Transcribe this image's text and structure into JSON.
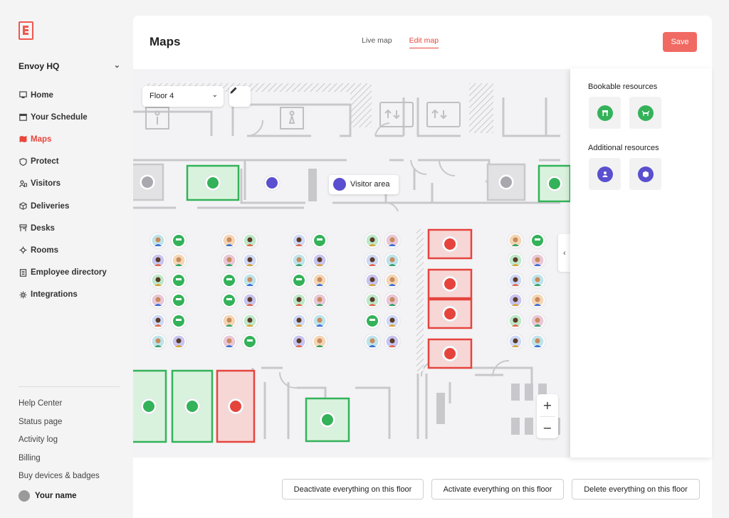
{
  "sidebar": {
    "org_name": "Envoy HQ",
    "nav": [
      {
        "label": "Home",
        "icon": "home-icon",
        "active": false
      },
      {
        "label": "Your Schedule",
        "icon": "calendar-icon",
        "active": false
      },
      {
        "label": "Maps",
        "icon": "map-icon",
        "active": true
      },
      {
        "label": "Protect",
        "icon": "shield-icon",
        "active": false
      },
      {
        "label": "Visitors",
        "icon": "visitor-badge-icon",
        "active": false
      },
      {
        "label": "Deliveries",
        "icon": "package-icon",
        "active": false
      },
      {
        "label": "Desks",
        "icon": "desk-icon",
        "active": false
      },
      {
        "label": "Rooms",
        "icon": "rooms-icon",
        "active": false
      },
      {
        "label": "Employee directory",
        "icon": "directory-icon",
        "active": false
      },
      {
        "label": "Integrations",
        "icon": "integrations-icon",
        "active": false
      }
    ],
    "footer": [
      "Help Center",
      "Status page",
      "Activity log",
      "Billing",
      "Buy devices & badges"
    ],
    "user_name": "Your name"
  },
  "header": {
    "title": "Maps",
    "tabs": [
      {
        "label": "Live map",
        "active": false
      },
      {
        "label": "Edit map",
        "active": true
      }
    ],
    "save_label": "Save"
  },
  "map": {
    "floor": "Floor 4",
    "tooltip": "Visitor area"
  },
  "panel": {
    "bookable_title": "Bookable resources",
    "additional_title": "Additional resources"
  },
  "actions": {
    "deactivate": "Deactivate everything on this floor",
    "activate": "Activate everything on this floor",
    "delete": "Delete everything on this floor"
  },
  "colors": {
    "accent": "#e9463c",
    "save": "#f06a63",
    "available": "#34b25a",
    "unavailable": "#e5443d",
    "visitor": "#5a4fcf"
  }
}
